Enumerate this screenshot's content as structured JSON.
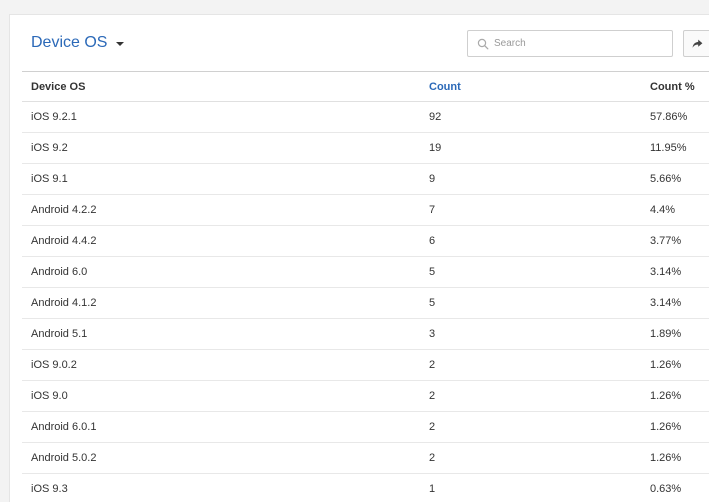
{
  "widget": {
    "title": "Device OS",
    "search_placeholder": "Search",
    "share_icon": "share-arrow-icon"
  },
  "table": {
    "columns": [
      "Device OS",
      "Count",
      "Count %"
    ],
    "sorted_column": "Count",
    "accent_color": "#2b69b8",
    "rows": [
      {
        "os": "iOS 9.2.1",
        "count": "92",
        "pct": "57.86%"
      },
      {
        "os": "iOS 9.2",
        "count": "19",
        "pct": "11.95%"
      },
      {
        "os": "iOS 9.1",
        "count": "9",
        "pct": "5.66%"
      },
      {
        "os": "Android 4.2.2",
        "count": "7",
        "pct": "4.4%"
      },
      {
        "os": "Android 4.4.2",
        "count": "6",
        "pct": "3.77%"
      },
      {
        "os": "Android 6.0",
        "count": "5",
        "pct": "3.14%"
      },
      {
        "os": "Android 4.1.2",
        "count": "5",
        "pct": "3.14%"
      },
      {
        "os": "Android 5.1",
        "count": "3",
        "pct": "1.89%"
      },
      {
        "os": "iOS 9.0.2",
        "count": "2",
        "pct": "1.26%"
      },
      {
        "os": "iOS 9.0",
        "count": "2",
        "pct": "1.26%"
      },
      {
        "os": "Android 6.0.1",
        "count": "2",
        "pct": "1.26%"
      },
      {
        "os": "Android 5.0.2",
        "count": "2",
        "pct": "1.26%"
      },
      {
        "os": "iOS 9.3",
        "count": "1",
        "pct": "0.63%"
      }
    ]
  }
}
